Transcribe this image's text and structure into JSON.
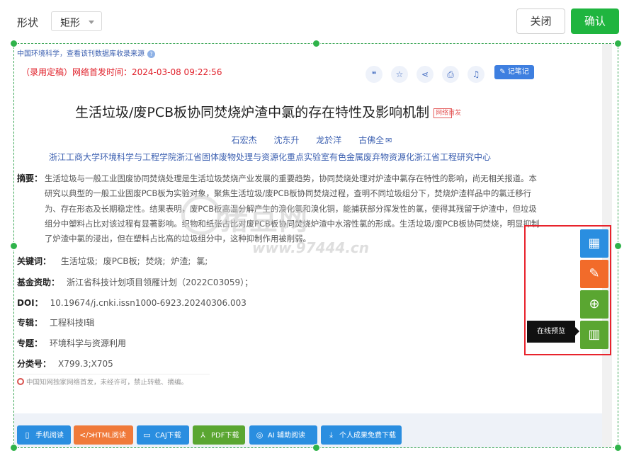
{
  "toolbar": {
    "shape_label": "形状",
    "shape_value": "矩形",
    "close_label": "关闭",
    "confirm_label": "确认"
  },
  "article": {
    "source_line": "中国环境科学，查看该刊数据库收录来源",
    "publish_time": "（录用定稿）网络首发时间：2024-03-08 09:22:56",
    "note_button": "记笔记",
    "title": "生活垃圾/废PCB板协同焚烧炉渣中氯的存在特性及影响机制",
    "title_badge": "网络首发",
    "authors": [
      "石宏杰",
      "沈东升",
      "龙於洋",
      "古佛全"
    ],
    "affiliation": "浙江工商大学环境科学与工程学院浙江省固体废物处理与资源化重点实验室有色金属废弃物资源化浙江省工程研究中心",
    "abstract_label": "摘要：",
    "abstract": "生活垃圾与一般工业固废协同焚烧处理是生活垃圾焚烧产业发展的重要趋势，协同焚烧处理对炉渣中氯存在特性的影响，尚无相关报道。本研究以典型的一般工业固废PCB板为实验对象，聚焦生活垃圾/废PCB板协同焚烧过程，查明不同垃圾组分下，焚烧炉渣样品中的氯迁移行为、存在形态及长期稳定性。结果表明，废PCB板高温分解产生的溴化氢和溴化铜，能捕获部分挥发性的氯，使得其残留于炉渣中，但垃圾组分中塑料占比对该过程有显著影响。织物和纸张占比对废PCB板协同焚烧炉渣中水溶性氯的形成。生活垃圾/废PCB板协同焚烧，明显抑制了炉渣中氯的浸出，但在塑料占比高的垃圾组分中，这种抑制作用被削弱。",
    "keywords_label": "关键词：",
    "keywords": [
      "生活垃圾;",
      "废PCB板;",
      "焚烧;",
      "炉渣;",
      "氯;"
    ],
    "fund_label": "基金资助：",
    "fund": "浙江省科技计划项目领雁计划（2022C03059）；",
    "doi_label": "DOI：",
    "doi": "10.19674/j.cnki.issn1000-6923.20240306.003",
    "series_label": "专辑：",
    "series": "工程科技Ⅰ辑",
    "topic_label": "专题：",
    "topic": "环境科学与资源利用",
    "class_label": "分类号：",
    "class_no": "X799.3;X705",
    "footnote": "中国知网独家网络首发，未经许可，禁止转载、摘编。"
  },
  "watermark": {
    "text": "猪豆网",
    "url": "www.97444.cn"
  },
  "download_buttons": [
    {
      "label": "手机阅读",
      "icon": "phone-icon",
      "color": "#2a8ee0"
    },
    {
      "label": "HTML阅读",
      "icon": "code-icon",
      "color": "#f07a3a"
    },
    {
      "label": "CAJ下载",
      "icon": "book-icon",
      "color": "#2a8ee0"
    },
    {
      "label": "PDF下载",
      "icon": "pdf-icon",
      "color": "#5aa631"
    },
    {
      "label": "AI 辅助阅读",
      "icon": "ai-icon",
      "color": "#2a8ee0"
    },
    {
      "label": "个人成果免费下载",
      "icon": "download-icon",
      "color": "#2a8ee0"
    }
  ],
  "side_panel": {
    "tooltip": "在线预览",
    "colors": {
      "apps": "#2a8ee0",
      "edit": "#f26b2a",
      "download": "#5aa631",
      "preview": "#5aa631"
    }
  },
  "colors": {
    "accent_green": "#1fb53f",
    "frame_green": "#3aa655",
    "highlight_red": "#e8232c",
    "link_blue": "#3b5fb0"
  }
}
